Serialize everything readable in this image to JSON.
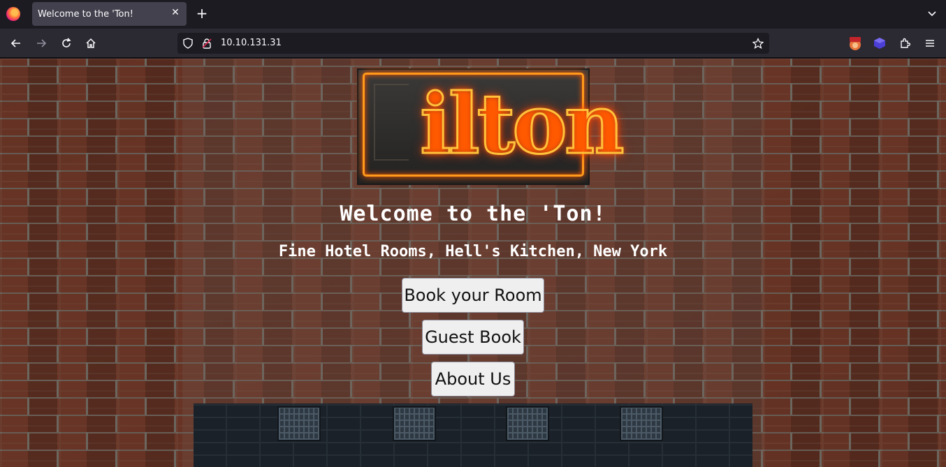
{
  "browser": {
    "tab_title": "Welcome to the 'Ton!",
    "url": "10.10.131.31",
    "accent": "#42414d"
  },
  "page": {
    "logo_text": "ilton",
    "title": "Welcome to the 'Ton!",
    "subtitle": "Fine Hotel Rooms, Hell's Kitchen, New York",
    "buttons": {
      "book": "Book your Room",
      "guestbook": "Guest Book",
      "about": "About Us"
    }
  },
  "icons": [
    "firefox-icon",
    "close-icon",
    "plus-icon",
    "chevron-down-icon",
    "back-arrow-icon",
    "forward-arrow-icon",
    "reload-icon",
    "home-icon",
    "shield-icon",
    "lock-icon",
    "star-icon",
    "burp-extension-icon",
    "extension-cube-icon",
    "extensions-puzzle-icon",
    "hamburger-menu-icon"
  ]
}
